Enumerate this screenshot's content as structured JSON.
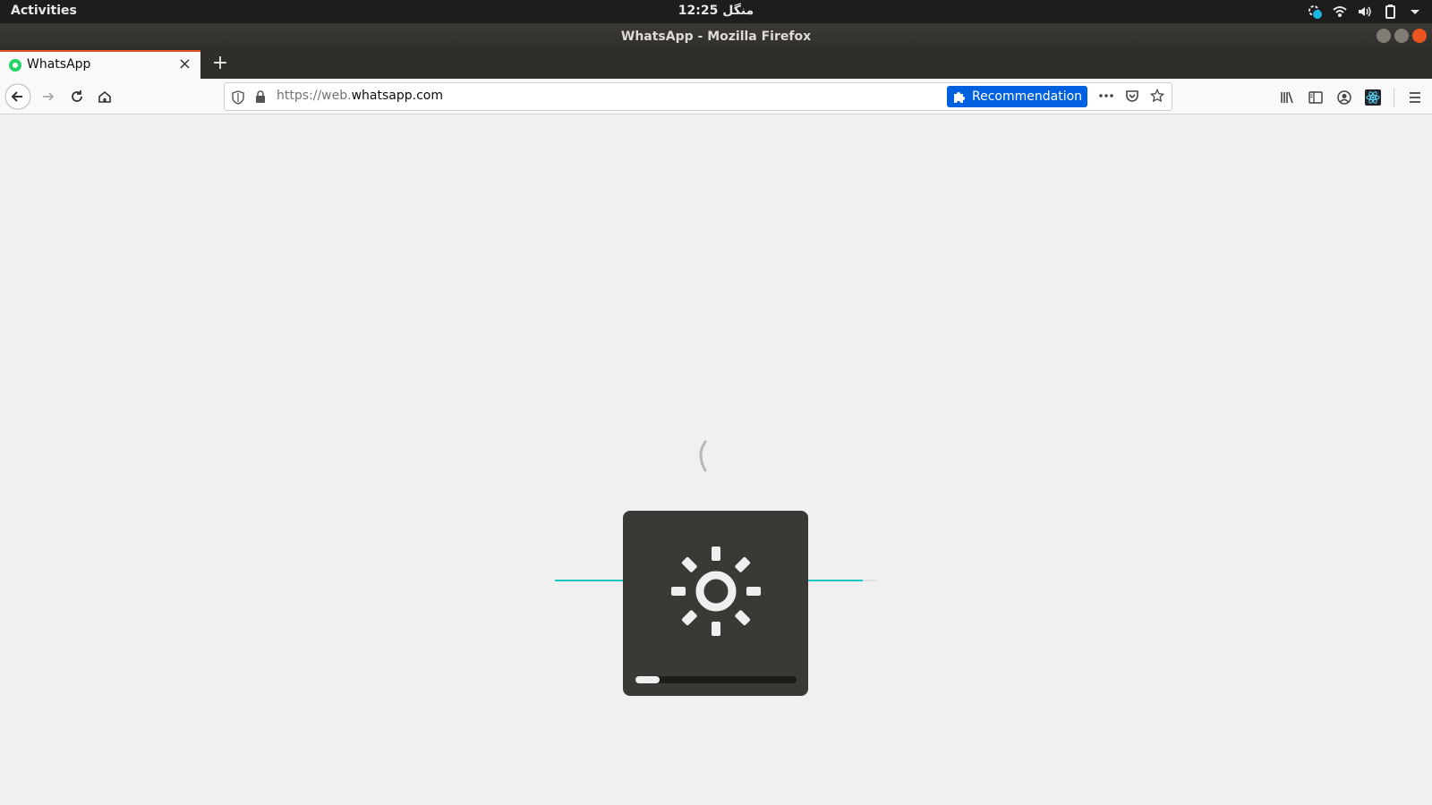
{
  "topbar": {
    "activities": "Activities",
    "clock": "منگل 12:25"
  },
  "window": {
    "title": "WhatsApp - Mozilla Firefox"
  },
  "tabs": [
    {
      "label": "WhatsApp",
      "active": true
    }
  ],
  "navbar": {
    "url_prefix": "https://web.",
    "url_domain": "whatsapp.com",
    "recommendation": "Recommendation"
  },
  "osd": {
    "icon": "brightness-icon",
    "level_percent": 15
  },
  "colors": {
    "accent_tab": "#e95420",
    "recommendation_bg": "#0060df",
    "progress_teal": "#1ac8c0",
    "osd_bg": "#3a3936"
  }
}
